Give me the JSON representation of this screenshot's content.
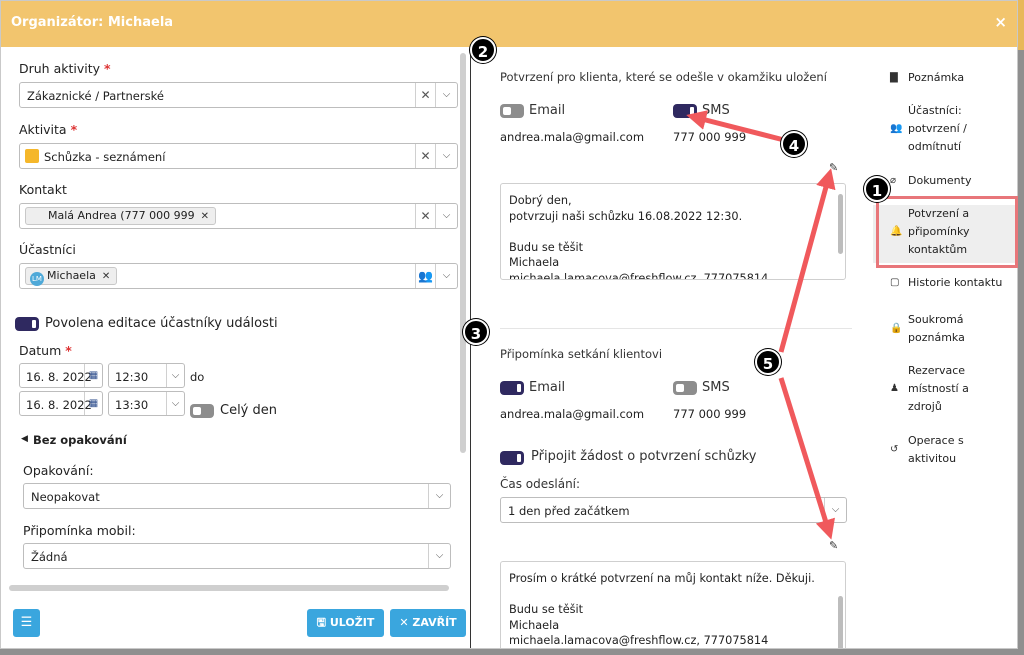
{
  "window": {
    "title": "Organizátor: Michaela",
    "close": "×"
  },
  "form": {
    "activity_type": {
      "label": "Druh aktivity",
      "value": "Zákaznické / Partnerské"
    },
    "activity": {
      "label": "Aktivita",
      "value": "Schůzka - seznámení"
    },
    "contact": {
      "label": "Kontakt",
      "value": "Malá Andrea (777 000 999"
    },
    "participants": {
      "label": "Účastníci",
      "avatar": "LM",
      "value": "Michaela"
    },
    "edit_toggle": "Povolena editace účastníky události",
    "date": {
      "label": "Datum",
      "start_date": "16. 8. 2022",
      "start_time": "12:30",
      "to": "do",
      "end_date": "16. 8. 2022",
      "end_time": "13:30",
      "all_day": "Celý den"
    },
    "repeat_toggle": "Bez opakování",
    "repeat": {
      "label": "Opakování:",
      "value": "Neopakovat"
    },
    "reminder": {
      "label": "Připomínka mobil:",
      "value": "Žádná"
    },
    "required_mark": "*"
  },
  "footer": {
    "save": "ULOŽIT",
    "close": "ZAVŘÍT"
  },
  "confirmation": {
    "heading": "Potvrzení pro klienta, které se odešle v okamžiku uložení",
    "email_label": "Email",
    "sms_label": "SMS",
    "email": "andrea.mala@gmail.com",
    "phone": "777 000 999",
    "message": [
      "Dobrý den,",
      "potvrzuji naši schůzku 16.08.2022 12:30.",
      "",
      "Budu se těšit",
      "Michaela",
      "michaela.lamacova@freshflow.cz, 777075814"
    ]
  },
  "reminder_section": {
    "heading": "Připomínka setkání klientovi",
    "email_label": "Email",
    "sms_label": "SMS",
    "email": "andrea.mala@gmail.com",
    "phone": "777 000 999",
    "attach_toggle": "Připojit žádost o potvrzení schůzky",
    "send_time_label": "Čas odeslání:",
    "send_time_value": "1 den před začátkem",
    "message": [
      "Prosím o krátké potvrzení na můj kontakt níže. Děkuji.",
      "",
      "Budu se těšit",
      "Michaela",
      "michaela.lamacova@freshflow.cz, 777075814"
    ]
  },
  "sidebar": [
    {
      "label": "Poznámka",
      "icon": "book-icon"
    },
    {
      "label": "Účastníci:\npotvrzení /\nodmítnutí",
      "icon": "people-icon"
    },
    {
      "label": "Dokumenty",
      "icon": "paperclip-icon"
    },
    {
      "label": "Potvrzení a\npřipomínky\nkontaktům",
      "icon": "bell-icon"
    },
    {
      "label": "Historie kontaktu",
      "icon": "history-icon"
    },
    {
      "label": "Soukromá\npoznámka",
      "icon": "lock-icon"
    },
    {
      "label": "Rezervace\nmístností a\nzdrojů",
      "icon": "presenter-icon"
    },
    {
      "label": "Operace s\naktivitou",
      "icon": "undo-icon"
    }
  ],
  "badges": [
    "1",
    "2",
    "3",
    "4",
    "5"
  ],
  "colors": {
    "header": "#f2c56e",
    "toggle_on": "#2f2960",
    "button": "#3aa6de",
    "arrow": "#f0595c",
    "highlight": "#e8767a"
  }
}
